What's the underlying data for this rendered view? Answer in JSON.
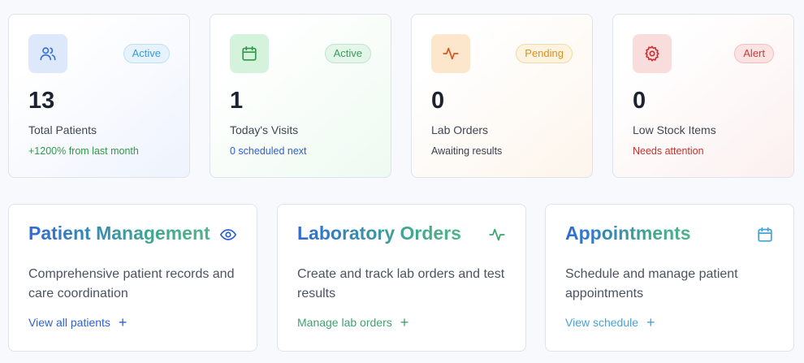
{
  "stats": [
    {
      "value": "13",
      "label": "Total Patients",
      "sub": "+1200% from last month",
      "badge": "Active",
      "icon": "users-icon"
    },
    {
      "value": "1",
      "label": "Today's Visits",
      "sub": "0 scheduled next",
      "badge": "Active",
      "icon": "calendar-icon"
    },
    {
      "value": "0",
      "label": "Lab Orders",
      "sub": "Awaiting results",
      "badge": "Pending",
      "icon": "activity-icon"
    },
    {
      "value": "0",
      "label": "Low Stock Items",
      "sub": "Needs attention",
      "badge": "Alert",
      "icon": "gear-icon"
    }
  ],
  "modules": [
    {
      "title": "Patient Management",
      "description": "Comprehensive patient records and care coordination",
      "link": "View all patients",
      "icon": "eye-icon"
    },
    {
      "title": "Laboratory Orders",
      "description": "Create and track lab orders and test results",
      "link": "Manage lab orders",
      "icon": "activity-icon"
    },
    {
      "title": "Appointments",
      "description": "Schedule and manage patient appointments",
      "link": "View schedule",
      "icon": "calendar-icon"
    }
  ],
  "colors": {
    "blue": "#2f62cf",
    "green": "#2f9a46",
    "orange": "#d89022",
    "red": "#c9302c"
  }
}
